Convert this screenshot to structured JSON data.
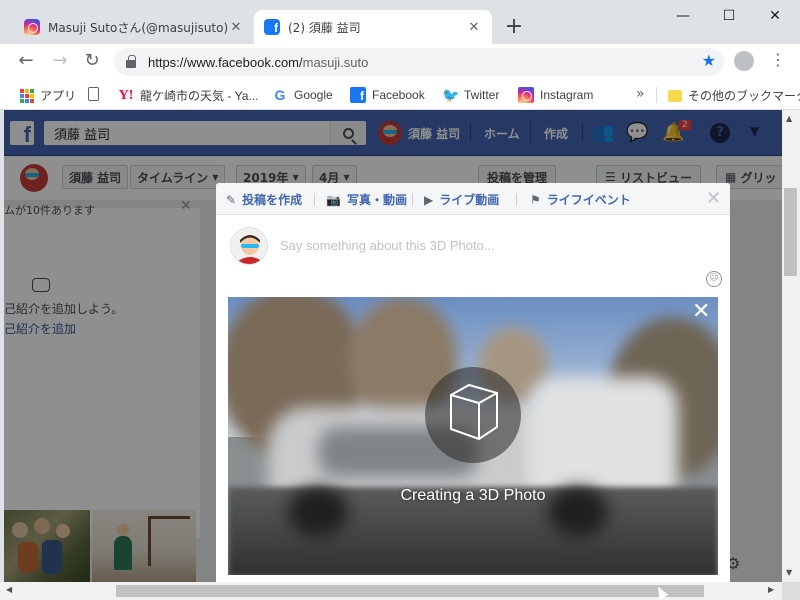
{
  "browser": {
    "tabs": [
      {
        "title": "Masuji Sutoさん(@masujisuto) • In",
        "favicon": "instagram-icon",
        "active": false
      },
      {
        "title": "(2) 須藤 益司",
        "favicon": "facebook-icon",
        "active": true
      }
    ],
    "new_tab": "+",
    "window_controls": {
      "minimize": "—",
      "maximize": "☐",
      "close": "✕"
    },
    "url_host": "https://www.facebook.com/",
    "url_path": "masuji.suto",
    "bookmarks": [
      {
        "label": "アプリ",
        "icon": "apps-grid-icon"
      },
      {
        "label": "",
        "icon": "document-icon"
      },
      {
        "label": "龍ケ崎市の天気 - Ya...",
        "icon": "yahoo-icon"
      },
      {
        "label": "Google",
        "icon": "google-icon"
      },
      {
        "label": "Facebook",
        "icon": "facebook-icon"
      },
      {
        "label": "Twitter",
        "icon": "twitter-icon"
      },
      {
        "label": "Instagram",
        "icon": "instagram-icon"
      }
    ],
    "bookmarks_more": "»",
    "other_bookmarks": "その他のブックマーク"
  },
  "facebook": {
    "search_value": "須藤 益司",
    "user_name": "須藤 益司",
    "nav_home": "ホーム",
    "nav_create": "作成",
    "notification_count": "2",
    "help": "?",
    "timeline": {
      "name": "須藤 益司",
      "timeline_label": "タイムライン",
      "year": "2019年",
      "month": "4月",
      "manage_posts": "投稿を管理",
      "list_view": "リストビュー",
      "grid_view": "グリッ"
    },
    "left": {
      "note": "ムが10件あります",
      "intro_prompt": "己紹介を追加しよう。",
      "intro_link": "己紹介を追加"
    }
  },
  "composer": {
    "tabs": [
      {
        "label": "投稿を作成",
        "icon": "pencil-icon"
      },
      {
        "label": "写真・動画",
        "icon": "camera-icon"
      },
      {
        "label": "ライブ動画",
        "icon": "video-icon"
      },
      {
        "label": "ライフイベント",
        "icon": "flag-icon"
      }
    ],
    "placeholder": "Say something about this 3D Photo...",
    "processing_text": "Creating a 3D Photo"
  },
  "colors": {
    "facebook_blue": "#4267b2",
    "chrome_accent": "#1a73e8",
    "notification_red": "#fa3e3e"
  }
}
